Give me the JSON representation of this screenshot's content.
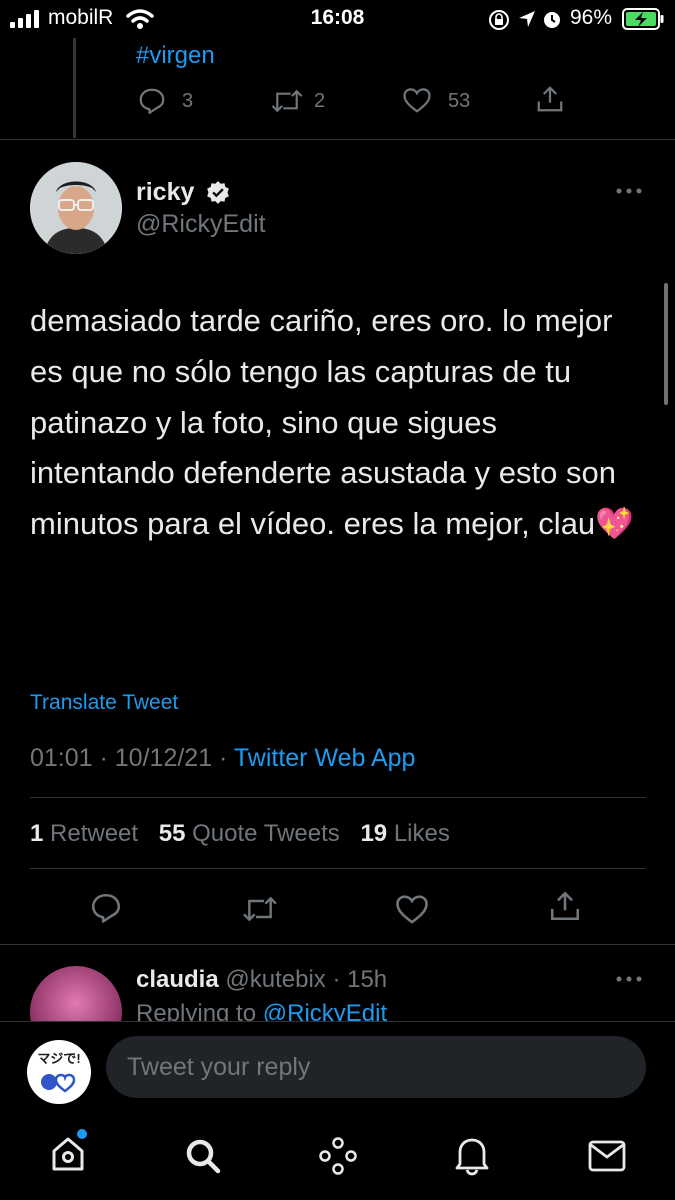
{
  "status_bar": {
    "carrier": "mobilR",
    "time": "16:08",
    "battery_percent": "96%",
    "icons": [
      "signal-bars-icon",
      "wifi-icon",
      "orientation-lock-icon",
      "location-icon",
      "alarm-icon",
      "battery-charging-icon"
    ]
  },
  "previous_tweet": {
    "hashtag": "#virgen",
    "replies": "3",
    "retweets": "2",
    "likes": "53"
  },
  "tweet": {
    "display_name": "ricky",
    "handle": "@RickyEdit",
    "text": "demasiado tarde cariño, eres oro. lo mejor es que no sólo tengo las capturas de tu patinazo y la foto, sino que sigues intentando defenderte asustada y esto son minutos para el vídeo. eres la mejor, clau💖",
    "translate_label": "Translate Tweet",
    "time": "01:01",
    "date": "10/12/21",
    "source": "Twitter Web App",
    "retweets_count": "1",
    "retweets_label": "Retweet",
    "quotes_count": "55",
    "quotes_label": "Quote Tweets",
    "likes_count": "19",
    "likes_label": "Likes"
  },
  "reply": {
    "display_name": "claudia",
    "handle": "@kutebix",
    "age": "15h",
    "replying_prefix": "Replying to",
    "replying_to": "@RickyEdit"
  },
  "composer": {
    "avatar_text": "マジで!",
    "placeholder": "Tweet your reply"
  },
  "colors": {
    "accent": "#1d9bf0",
    "text_primary": "#e7e9ea",
    "text_secondary": "#71767b",
    "background": "#000000"
  }
}
